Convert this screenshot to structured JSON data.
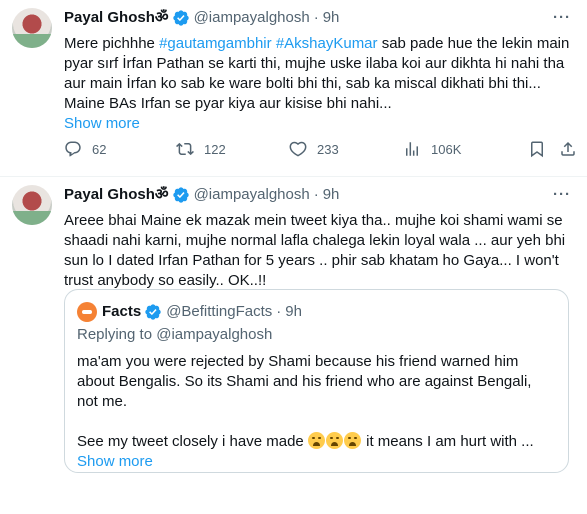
{
  "tweets": [
    {
      "author_name": "Payal Ghosh",
      "author_symbol": "ॐ",
      "handle": "@iampayalghosh",
      "separator": "·",
      "time": "9h",
      "more": "···",
      "text_pre": "Mere pichhhe ",
      "hashtag1": "#gautamgambhir",
      "text_mid": " ",
      "hashtag2": "#AkshayKumar",
      "text_post": " sab pade hue the lekin main pyar sırf İrfan Pathan se karti thi, mujhe uske ilaba koi aur dikhta hi nahi tha aur main İrfan ko sab ke ware bolti bhi thi, sab ka miscal dikhati bhi thi... Maine BAs Irfan se pyar kiya aur kisise bhi nahi...",
      "show_more": "Show more",
      "stats": {
        "replies": "62",
        "retweets": "122",
        "likes": "233",
        "views": "106K"
      }
    },
    {
      "author_name": "Payal Ghosh",
      "author_symbol": "ॐ",
      "handle": "@iampayalghosh",
      "separator": "·",
      "time": "9h",
      "more": "···",
      "text": "Areee bhai Maine ek mazak mein tweet kiya tha.. mujhe koi shami wami se shaadi nahi karni, mujhe normal lafla chalega lekin loyal wala ... aur yeh bhi sun lo I dated Irfan Pathan for 5 years .. phir sab khatam ho Gaya... I won't trust anybody so easily.. OK..!!",
      "quote": {
        "author_name": "Facts",
        "handle": "@BefittingFacts",
        "separator": "·",
        "time": "9h",
        "replying_to": "Replying to @iampayalghosh",
        "text1": "ma'am you were rejected by Shami because his friend warned him about Bengalis. So its Shami and his friend who are against Bengali, not me.",
        "text2_pre": "See my tweet closely i have made ",
        "text2_post": " it means I am hurt with ...",
        "emoji_names": [
          "loudly-crying-face",
          "loudly-crying-face",
          "loudly-crying-face"
        ],
        "show_more": "Show more"
      }
    }
  ],
  "colors": {
    "accent": "#1d9bf0",
    "muted": "#536471",
    "text": "#0f1419",
    "border": "#cfd9de"
  }
}
